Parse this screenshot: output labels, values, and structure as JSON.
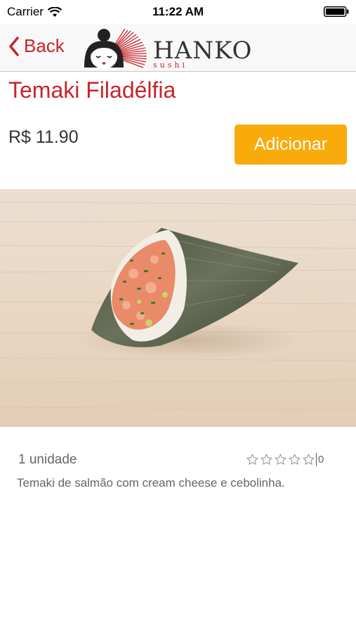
{
  "status": {
    "carrier": "Carrier",
    "time": "11:22 AM"
  },
  "nav": {
    "back_label": "Back",
    "brand": "HANKO",
    "brand_sub": "sushi"
  },
  "product": {
    "name": "Temaki Filadélfia",
    "price": "R$ 11.90",
    "add_label": "Adicionar",
    "unit": "1 unidade",
    "rating_value": 0,
    "rating_max": 5,
    "rating_count": "0",
    "description": "Temaki de salmão com cream cheese e cebolinha."
  },
  "colors": {
    "accent": "#c8242c",
    "button": "#f8ab0b"
  },
  "icons": {
    "back": "chevron-left-icon",
    "wifi": "wifi-icon",
    "battery": "battery-icon",
    "star": "star-outline-icon"
  }
}
